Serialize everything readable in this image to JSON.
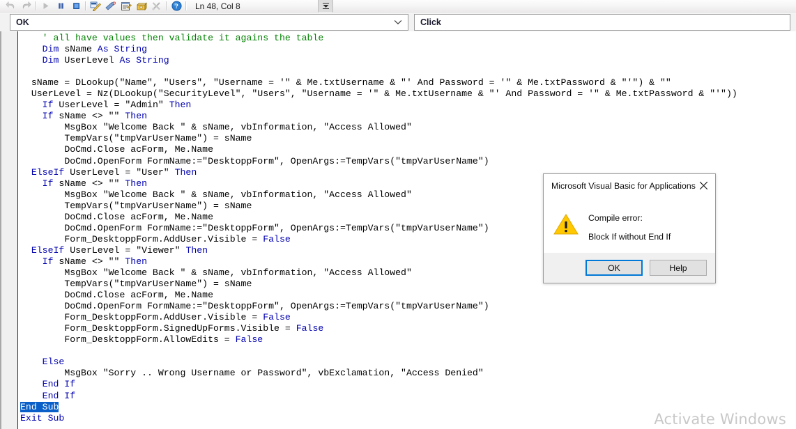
{
  "toolbar": {
    "status_text": "Ln 48, Col 8",
    "icons": [
      {
        "name": "undo-icon",
        "label": "Undo"
      },
      {
        "name": "redo-icon",
        "label": "Redo"
      },
      {
        "name": "run-icon",
        "label": "Run Sub/UserForm"
      },
      {
        "name": "break-icon",
        "label": "Break"
      },
      {
        "name": "reset-icon",
        "label": "Reset"
      },
      {
        "name": "design-mode-icon",
        "label": "Design Mode"
      },
      {
        "name": "project-explorer-icon",
        "label": "Project Explorer"
      },
      {
        "name": "properties-window-icon",
        "label": "Properties Window"
      },
      {
        "name": "object-browser-icon",
        "label": "Object Browser"
      },
      {
        "name": "toolbox-icon",
        "label": "Toolbox"
      },
      {
        "name": "help-icon",
        "label": "Help"
      }
    ]
  },
  "combo": {
    "object_value": "OK",
    "procedure_value": "Click"
  },
  "code": {
    "lines": [
      {
        "indent": 4,
        "segments": [
          {
            "t": "' all have values then validate it agains the table",
            "c": "cmt"
          }
        ]
      },
      {
        "indent": 4,
        "segments": [
          {
            "t": "Dim ",
            "c": "kw"
          },
          {
            "t": "sName ",
            "c": ""
          },
          {
            "t": "As String",
            "c": "kw"
          }
        ]
      },
      {
        "indent": 4,
        "segments": [
          {
            "t": "Dim ",
            "c": "kw"
          },
          {
            "t": "UserLevel ",
            "c": ""
          },
          {
            "t": "As String",
            "c": "kw"
          }
        ]
      },
      {
        "indent": 0,
        "segments": []
      },
      {
        "indent": 2,
        "segments": [
          {
            "t": "sName = DLookup(\"Name\", \"Users\", \"Username = '\" & Me.txtUsername & \"' And Password = '\" & Me.txtPassword & \"'\") & \"\"",
            "c": ""
          }
        ]
      },
      {
        "indent": 2,
        "segments": [
          {
            "t": "UserLevel = Nz(DLookup(\"SecurityLevel\", \"Users\", \"Username = '\" & Me.txtUsername & \"' And Password = '\" & Me.txtPassword & \"'\"))",
            "c": ""
          }
        ]
      },
      {
        "indent": 4,
        "segments": [
          {
            "t": "If ",
            "c": "kw"
          },
          {
            "t": "UserLevel = \"Admin\" ",
            "c": ""
          },
          {
            "t": "Then",
            "c": "kw"
          }
        ]
      },
      {
        "indent": 4,
        "segments": [
          {
            "t": "If ",
            "c": "kw"
          },
          {
            "t": "sName <> \"\" ",
            "c": ""
          },
          {
            "t": "Then",
            "c": "kw"
          }
        ]
      },
      {
        "indent": 8,
        "segments": [
          {
            "t": "MsgBox \"Welcome Back \" & sName, vbInformation, \"Access Allowed\"",
            "c": ""
          }
        ]
      },
      {
        "indent": 8,
        "segments": [
          {
            "t": "TempVars(\"tmpVarUserName\") = sName",
            "c": ""
          }
        ]
      },
      {
        "indent": 8,
        "segments": [
          {
            "t": "DoCmd.Close acForm, Me.Name",
            "c": ""
          }
        ]
      },
      {
        "indent": 8,
        "segments": [
          {
            "t": "DoCmd.OpenForm FormName:=\"DesktoppForm\", OpenArgs:=TempVars(\"tmpVarUserName\")",
            "c": ""
          }
        ]
      },
      {
        "indent": 2,
        "segments": [
          {
            "t": "ElseIf ",
            "c": "kw"
          },
          {
            "t": "UserLevel = \"User\" ",
            "c": ""
          },
          {
            "t": "Then",
            "c": "kw"
          }
        ]
      },
      {
        "indent": 4,
        "segments": [
          {
            "t": "If ",
            "c": "kw"
          },
          {
            "t": "sName <> \"\" ",
            "c": ""
          },
          {
            "t": "Then",
            "c": "kw"
          }
        ]
      },
      {
        "indent": 8,
        "segments": [
          {
            "t": "MsgBox \"Welcome Back \" & sName, vbInformation, \"Access Allowed\"",
            "c": ""
          }
        ]
      },
      {
        "indent": 8,
        "segments": [
          {
            "t": "TempVars(\"tmpVarUserName\") = sName",
            "c": ""
          }
        ]
      },
      {
        "indent": 8,
        "segments": [
          {
            "t": "DoCmd.Close acForm, Me.Name",
            "c": ""
          }
        ]
      },
      {
        "indent": 8,
        "segments": [
          {
            "t": "DoCmd.OpenForm FormName:=\"DesktoppForm\", OpenArgs:=TempVars(\"tmpVarUserName\")",
            "c": ""
          }
        ]
      },
      {
        "indent": 8,
        "segments": [
          {
            "t": "Form_DesktoppForm.AddUser.Visible = ",
            "c": ""
          },
          {
            "t": "False",
            "c": "kw"
          }
        ]
      },
      {
        "indent": 2,
        "segments": [
          {
            "t": "ElseIf ",
            "c": "kw"
          },
          {
            "t": "UserLevel = \"Viewer\" ",
            "c": ""
          },
          {
            "t": "Then",
            "c": "kw"
          }
        ]
      },
      {
        "indent": 4,
        "segments": [
          {
            "t": "If ",
            "c": "kw"
          },
          {
            "t": "sName <> \"\" ",
            "c": ""
          },
          {
            "t": "Then",
            "c": "kw"
          }
        ]
      },
      {
        "indent": 8,
        "segments": [
          {
            "t": "MsgBox \"Welcome Back \" & sName, vbInformation, \"Access Allowed\"",
            "c": ""
          }
        ]
      },
      {
        "indent": 8,
        "segments": [
          {
            "t": "TempVars(\"tmpVarUserName\") = sName",
            "c": ""
          }
        ]
      },
      {
        "indent": 8,
        "segments": [
          {
            "t": "DoCmd.Close acForm, Me.Name",
            "c": ""
          }
        ]
      },
      {
        "indent": 8,
        "segments": [
          {
            "t": "DoCmd.OpenForm FormName:=\"DesktoppForm\", OpenArgs:=TempVars(\"tmpVarUserName\")",
            "c": ""
          }
        ]
      },
      {
        "indent": 8,
        "segments": [
          {
            "t": "Form_DesktoppForm.AddUser.Visible = ",
            "c": ""
          },
          {
            "t": "False",
            "c": "kw"
          }
        ]
      },
      {
        "indent": 8,
        "segments": [
          {
            "t": "Form_DesktoppForm.SignedUpForms.Visible = ",
            "c": ""
          },
          {
            "t": "False",
            "c": "kw"
          }
        ]
      },
      {
        "indent": 8,
        "segments": [
          {
            "t": "Form_DesktoppForm.AllowEdits = ",
            "c": ""
          },
          {
            "t": "False",
            "c": "kw"
          }
        ]
      },
      {
        "indent": 0,
        "segments": []
      },
      {
        "indent": 4,
        "segments": [
          {
            "t": "Else",
            "c": "kw"
          }
        ]
      },
      {
        "indent": 8,
        "segments": [
          {
            "t": "MsgBox \"Sorry .. Wrong Username or Password\", vbExclamation, \"Access Denied\"",
            "c": ""
          }
        ]
      },
      {
        "indent": 4,
        "segments": [
          {
            "t": "End If",
            "c": "kw"
          }
        ]
      },
      {
        "indent": 4,
        "segments": [
          {
            "t": "End If",
            "c": "kw"
          }
        ]
      },
      {
        "indent": 0,
        "selected": true,
        "segments": [
          {
            "t": "End Sub",
            "c": "kw"
          }
        ]
      },
      {
        "indent": 0,
        "segments": [
          {
            "t": "Exit Sub",
            "c": "kw"
          }
        ]
      }
    ]
  },
  "dialog": {
    "title": "Microsoft Visual Basic for Applications",
    "message_line1": "Compile error:",
    "message_line2": "Block If without End If",
    "ok_label": "OK",
    "help_label": "Help",
    "close_label": "Close"
  },
  "watermark": {
    "text": "Activate Windows"
  },
  "colors": {
    "keyword": "#0000b0",
    "comment": "#008000",
    "selection": "#0a60c8",
    "accent": "#0078d7",
    "warning": "#ffc800"
  }
}
